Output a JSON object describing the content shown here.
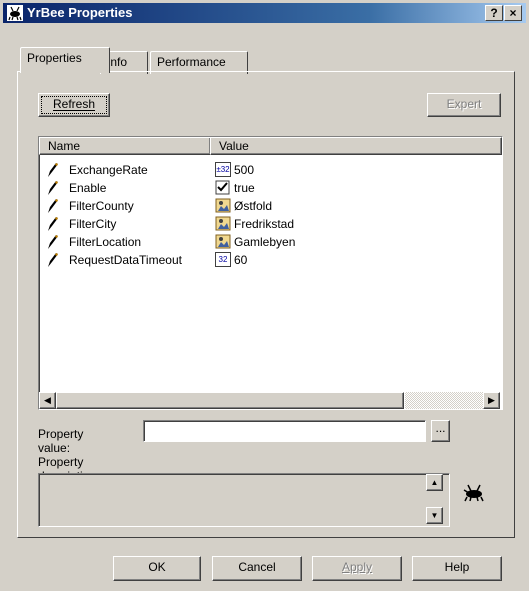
{
  "window": {
    "title": "YrBee Properties",
    "help_label": "?",
    "close_label": "×"
  },
  "tabs": [
    {
      "label": "Properties"
    },
    {
      "label": "Info"
    },
    {
      "label": "Performance"
    }
  ],
  "buttons": {
    "refresh": "Refresh",
    "expert": "Expert",
    "browse": "...",
    "ok": "OK",
    "cancel": "Cancel",
    "apply": "Apply",
    "help": "Help"
  },
  "list": {
    "columns": [
      "Name",
      "Value"
    ],
    "rows": [
      {
        "name": "ExchangeRate",
        "value": "500",
        "type_icon": "int32-icon",
        "type_text": "±32"
      },
      {
        "name": "Enable",
        "value": "true",
        "type_icon": "checkbox-icon",
        "type_text": ""
      },
      {
        "name": "FilterCounty",
        "value": "Østfold",
        "type_icon": "string-icon",
        "type_text": ""
      },
      {
        "name": "FilterCity",
        "value": "Fredrikstad",
        "type_icon": "string-icon",
        "type_text": ""
      },
      {
        "name": "FilterLocation",
        "value": "Gamlebyen",
        "type_icon": "string-icon",
        "type_text": ""
      },
      {
        "name": "RequestDataTimeout",
        "value": "60",
        "type_icon": "uint32-icon",
        "type_text": "32"
      }
    ]
  },
  "property_value": {
    "label": "Property value:",
    "value": ""
  },
  "property_description": {
    "label": "Property description:",
    "value": ""
  },
  "colors": {
    "titlebar": "#0a246a",
    "face": "#d4d0c8"
  }
}
